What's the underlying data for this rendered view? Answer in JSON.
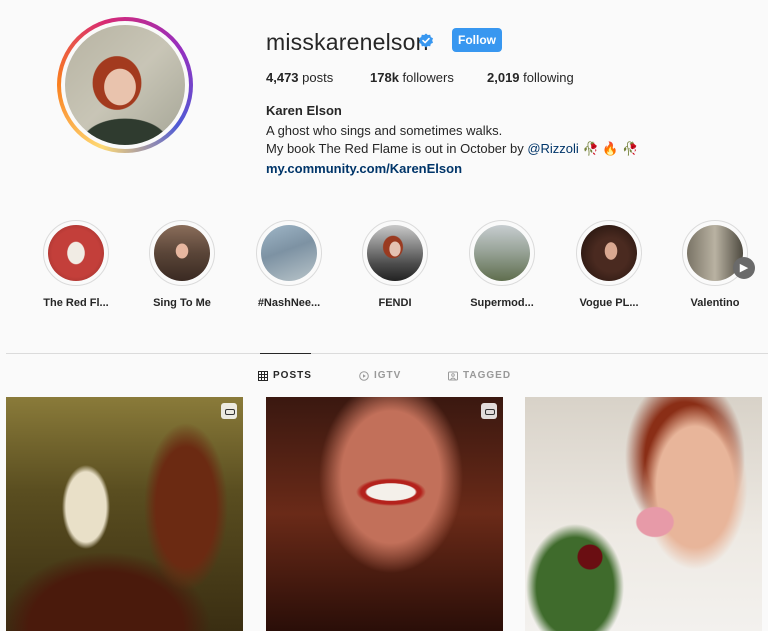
{
  "profile": {
    "username": "misskarenelson",
    "follow_label": "Follow",
    "full_name": "Karen Elson",
    "bio_line_1": "A ghost who sings and sometimes walks.",
    "bio_line_2_prefix": "My book The Red Flame is out in October by ",
    "bio_mention": "@Rizzoli",
    "bio_emojis": "🥀 🔥 🥀",
    "link": "my.community.com/KarenElson"
  },
  "stats": {
    "posts_count": "4,473",
    "posts_label": "posts",
    "followers_count": "178k",
    "followers_label": "followers",
    "following_count": "2,019",
    "following_label": "following"
  },
  "highlights": [
    {
      "label": "The Red Fl..."
    },
    {
      "label": "Sing To Me"
    },
    {
      "label": "#NashNee..."
    },
    {
      "label": "FENDI"
    },
    {
      "label": "Supermod..."
    },
    {
      "label": "Vogue PL..."
    },
    {
      "label": "Valentino"
    }
  ],
  "tabs": {
    "posts": "POSTS",
    "igtv": "IGTV",
    "tagged": "TAGGED"
  },
  "colors": {
    "follow_button": "#3897f0",
    "link": "#003569",
    "verified": "#3897f0"
  },
  "icons": {
    "verified": "verified-badge-icon",
    "next": "chevron-right-icon",
    "posts_tab": "grid-icon",
    "igtv_tab": "igtv-icon",
    "tagged_tab": "tag-icon",
    "post_type": "carousel-icon"
  }
}
